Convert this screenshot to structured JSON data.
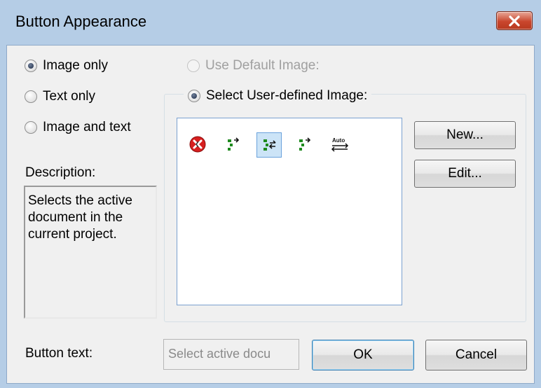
{
  "window": {
    "title": "Button Appearance"
  },
  "appearance": {
    "options": [
      {
        "label": "Image only",
        "checked": true
      },
      {
        "label": "Text only",
        "checked": false
      },
      {
        "label": "Image and text",
        "checked": false
      }
    ]
  },
  "image_source": {
    "default_label": "Use Default Image:",
    "user_defined_label": "Select User-defined Image:",
    "selected": "user_defined"
  },
  "description": {
    "label": "Description:",
    "text": "Selects the active\ndocument in the\ncurrent project."
  },
  "icons": [
    {
      "name": "delete-red-x-icon",
      "selected": false
    },
    {
      "name": "tree-add-icon",
      "selected": false
    },
    {
      "name": "tree-sync-icon",
      "selected": true
    },
    {
      "name": "tree-add-alt-icon",
      "selected": false
    },
    {
      "name": "auto-sync-icon",
      "selected": false,
      "caption": "Auto"
    }
  ],
  "buttons": {
    "new": "New...",
    "edit": "Edit...",
    "ok": "OK",
    "cancel": "Cancel"
  },
  "button_text": {
    "label": "Button text:",
    "value": "Select active docu"
  },
  "colors": {
    "titlebar": "#b5cde6",
    "close": "#c9462d",
    "green_icon": "#1e8a1e"
  }
}
